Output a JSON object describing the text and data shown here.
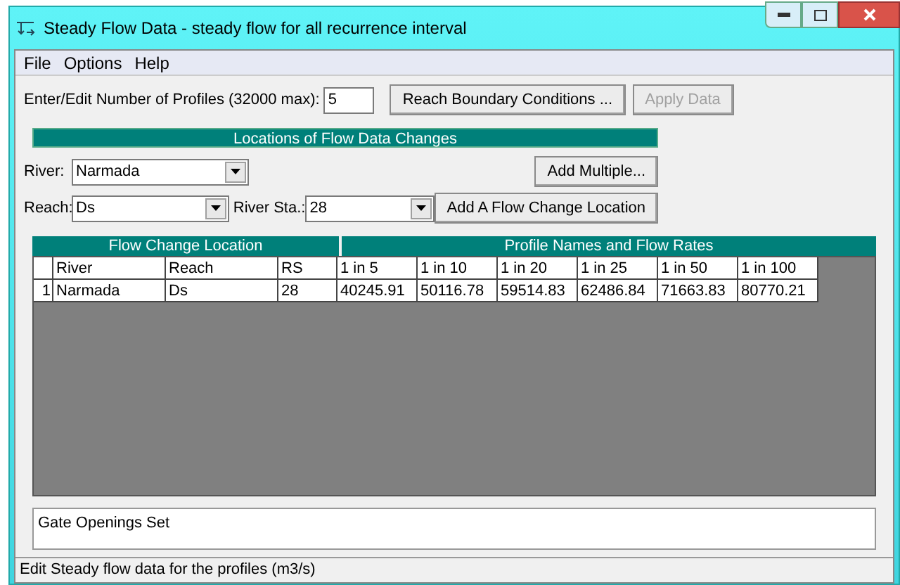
{
  "window": {
    "title": "Steady Flow Data - steady flow for all recurrence interval"
  },
  "menu": [
    "File",
    "Options",
    "Help"
  ],
  "profiles": {
    "label": "Enter/Edit Number of Profiles (32000 max):",
    "value": "5"
  },
  "buttons": [
    {
      "label": "Reach Boundary Conditions ...",
      "disabled": false
    },
    {
      "label": "Apply Data",
      "disabled": true
    }
  ],
  "locations_header": "Locations of Flow Data Changes",
  "river": {
    "label": "River:",
    "value": "Narmada"
  },
  "add_multiple": "Add Multiple...",
  "reach": {
    "label": "Reach:",
    "value": "Ds"
  },
  "river_sta": {
    "label": "River Sta.:",
    "value": "28"
  },
  "add_location": "Add A Flow Change Location",
  "table": {
    "group_left": "Flow Change Location",
    "group_right": "Profile Names and Flow Rates",
    "columns": [
      "River",
      "Reach",
      "RS"
    ],
    "profile_columns": [
      "1 in 5",
      "1 in 10",
      "1 in 20",
      "1 in 25",
      "1 in 50",
      "1 in 100"
    ],
    "rows": [
      {
        "number": "1",
        "cells": [
          "Narmada",
          "Ds",
          "28"
        ],
        "flows": [
          "40245.91",
          "50116.78",
          "59514.83",
          "62486.84",
          "71663.83",
          "80770.21"
        ]
      }
    ]
  },
  "notes": "Gate Openings Set",
  "status_bar": "Edit Steady flow data for the profiles (m3/s)"
}
